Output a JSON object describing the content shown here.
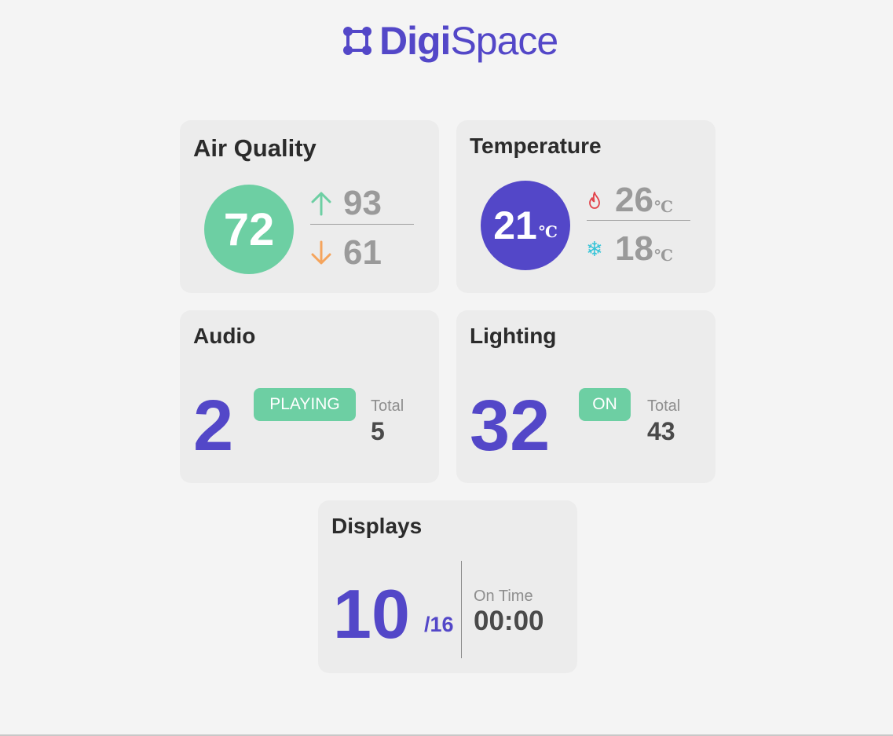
{
  "brand": {
    "name_bold": "Digi",
    "name_light": "Space",
    "icon": "logo-mark-icon",
    "color": "#5347c8"
  },
  "colors": {
    "accent": "#5347c8",
    "success": "#6dcfa3",
    "up_arrow": "#6dcfa3",
    "down_arrow": "#f5a45c",
    "hot": "#e2424a",
    "cold": "#36c4d8"
  },
  "air_quality": {
    "title": "Air Quality",
    "current": "72",
    "high": "93",
    "low": "61",
    "high_icon": "arrow-up-icon",
    "low_icon": "arrow-down-icon"
  },
  "temperature": {
    "title": "Temperature",
    "current": "21",
    "unit": "℃",
    "high": "26",
    "low": "18",
    "high_icon": "flame-icon",
    "low_icon": "snowflake-icon",
    "snow_glyph": "❄"
  },
  "audio": {
    "title": "Audio",
    "active": "2",
    "status": "PLAYING",
    "total_label": "Total",
    "total": "5"
  },
  "lighting": {
    "title": "Lighting",
    "active": "32",
    "status": "ON",
    "total_label": "Total",
    "total": "43"
  },
  "displays": {
    "title": "Displays",
    "active": "10",
    "total": "/16",
    "ontime_label": "On Time",
    "ontime": "00:00"
  }
}
